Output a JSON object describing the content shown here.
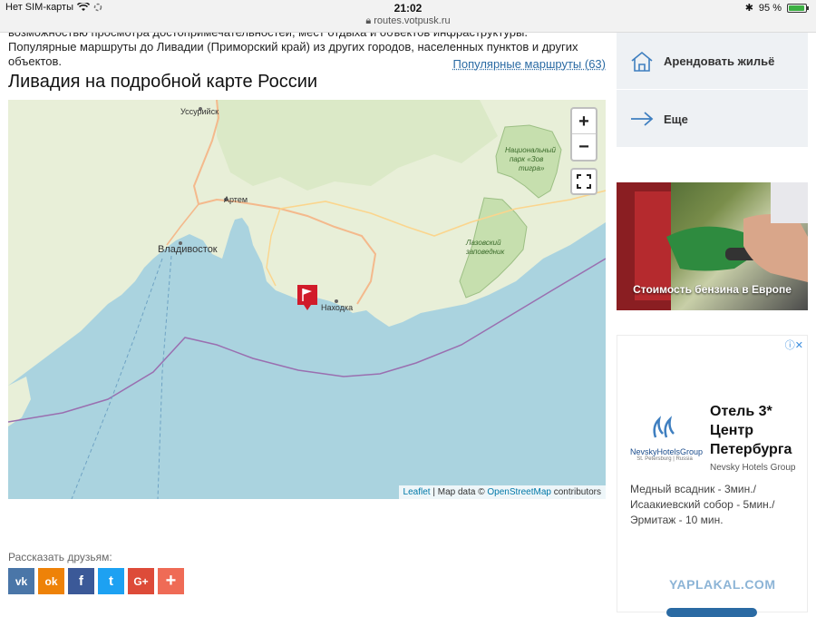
{
  "status_bar": {
    "carrier": "Нет SIM-карты",
    "time": "21:02",
    "url": "routes.votpusk.ru",
    "battery_text": "95 %",
    "battery_color": "#3cb043"
  },
  "intro": {
    "text": "возможностью просмотра достопримечательностей, мест отдыха и объектов инфраструктуры. Популярные маршруты до Ливадии (Приморский край) из других городов, населенных пунктов и других объектов.",
    "routes_link": "Популярные маршруты (63)"
  },
  "map": {
    "title": "Ливадия на подробной карте России",
    "zoom_in": "+",
    "zoom_out": "−",
    "labels": {
      "ussuriysk": "Уссурийск",
      "artem": "Артем",
      "vladivostok": "Владивосток",
      "nakhodka": "Находка",
      "park_line1": "Национальный",
      "park_line2": "парк «Зов",
      "park_line3": "тигра»",
      "reserve_line1": "Лазовский",
      "reserve_line2": "заповедник"
    },
    "attribution": {
      "leaflet": "Leaflet",
      "sep": " | Map data © ",
      "osm": "OpenStreetMap",
      "rest": " contributors"
    },
    "colors": {
      "water": "#aad3df",
      "land": "#e8efd8",
      "park": "#c6dfae",
      "marker": "#d11b2a",
      "border": "#9a6fb0"
    }
  },
  "share": {
    "label": "Рассказать друзьям:",
    "buttons": [
      {
        "text": "vk",
        "color": "#4a76a8"
      },
      {
        "text": "ok",
        "color": "#ee8208"
      },
      {
        "text": "f",
        "color": "#3b5998"
      },
      {
        "text": "t",
        "color": "#1da1f2"
      },
      {
        "text": "G+",
        "color": "#dd4b39"
      },
      {
        "text": "+",
        "color": "#ef6b56"
      }
    ]
  },
  "sidebar": {
    "rent_label": "Арендовать жильё",
    "more_label": "Еще",
    "banner_caption": "Стоимость бензина в Европе"
  },
  "ad": {
    "logo_brand": "NevskyHotelsGroup",
    "logo_sub": "St. Petersburg | Russia",
    "title": "Отель 3* Центр Петербурга",
    "subtitle": "Nevsky Hotels Group",
    "description": "Медный всадник - 3мин./ Исаакиевский собор - 5мин./ Эрмитаж - 10 мин."
  },
  "watermark": "YAPLAKAL.COM"
}
